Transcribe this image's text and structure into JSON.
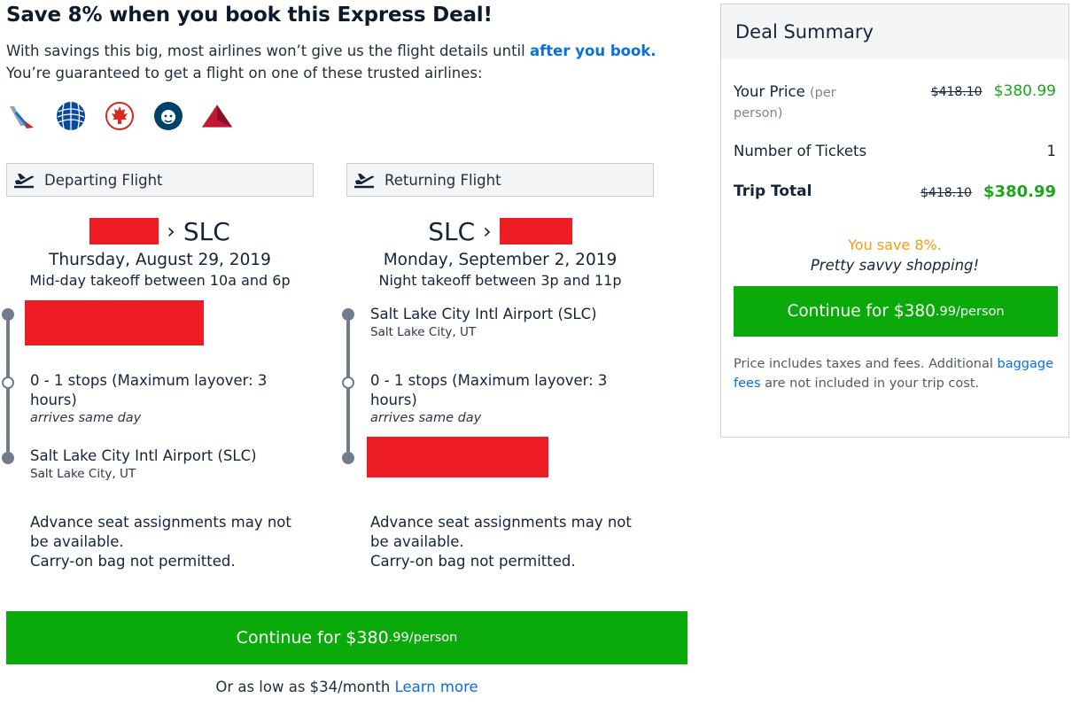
{
  "headline": "Save 8% when you book this Express Deal!",
  "intro": {
    "line1_prefix": "With savings this big, most airlines won’t give us the flight details until ",
    "line1_link": "after you book.",
    "line2": "You’re guaranteed to get a flight on one of these trusted airlines:"
  },
  "airlines": [
    {
      "name": "American Airlines",
      "icon": "american-airlines-logo-icon",
      "color": "#d2232a"
    },
    {
      "name": "United",
      "icon": "united-globe-logo-icon",
      "color": "#0a4a9e"
    },
    {
      "name": "Air Canada",
      "icon": "air-canada-maple-logo-icon",
      "color": "#d52b1e"
    },
    {
      "name": "Alaska Airlines",
      "icon": "alaska-airlines-eskimo-logo-icon",
      "color": "#01426a"
    },
    {
      "name": "Delta",
      "icon": "delta-widget-logo-icon",
      "color": "#c01933"
    }
  ],
  "departing": {
    "header": "Departing Flight",
    "icon": "plane-takeoff-icon",
    "dest_code": "SLC",
    "route_separator": "›",
    "date": "Thursday, August 29, 2019",
    "window": "Mid-day takeoff between 10a and 6p",
    "stops_text": "0 - 1 stops (Maximum layover: 3 hours)",
    "arrives_note": "arrives same day",
    "arrival_airport": "Salt Lake City Intl Airport (SLC)",
    "arrival_city": "Salt Lake City, UT",
    "note1": "Advance seat assignments may not be available.",
    "note2": "Carry-on bag not permitted."
  },
  "returning": {
    "header": "Returning Flight",
    "icon": "plane-takeoff-icon",
    "origin_code": "SLC",
    "route_separator": "›",
    "date": "Monday, September 2, 2019",
    "window": "Night takeoff between 3p and 11p",
    "departure_airport": "Salt Lake City Intl Airport (SLC)",
    "departure_city": "Salt Lake City, UT",
    "stops_text": "0 - 1 stops (Maximum layover: 3 hours)",
    "arrives_note": "arrives same day",
    "note1": "Advance seat assignments may not be available.",
    "note2": "Carry-on bag not permitted."
  },
  "cta": {
    "prefix": "Continue for $380",
    "cents": ".99",
    "suffix": "/person"
  },
  "financing": {
    "text": "Or as low as $34/month",
    "link": "Learn more"
  },
  "summary": {
    "title": "Deal Summary",
    "your_price_label": "Your Price",
    "your_price_sub": "(per person)",
    "old_price": "$418.10",
    "new_price": "$380.99",
    "tickets_label": "Number of Tickets",
    "tickets_value": "1",
    "total_label": "Trip Total",
    "total_old": "$418.10",
    "total_new": "$380.99",
    "savings": "You save 8%.",
    "savvy": "Pretty savvy shopping!",
    "fine_prefix": "Price includes taxes and fees. Additional ",
    "fine_link": "baggage fees",
    "fine_suffix": " are not included in your trip cost."
  },
  "colors": {
    "accent_green": "#0aaa0a",
    "link_blue": "#0a6fe0",
    "savings_orange": "#f29d0f",
    "redaction": "#ee1c25"
  }
}
